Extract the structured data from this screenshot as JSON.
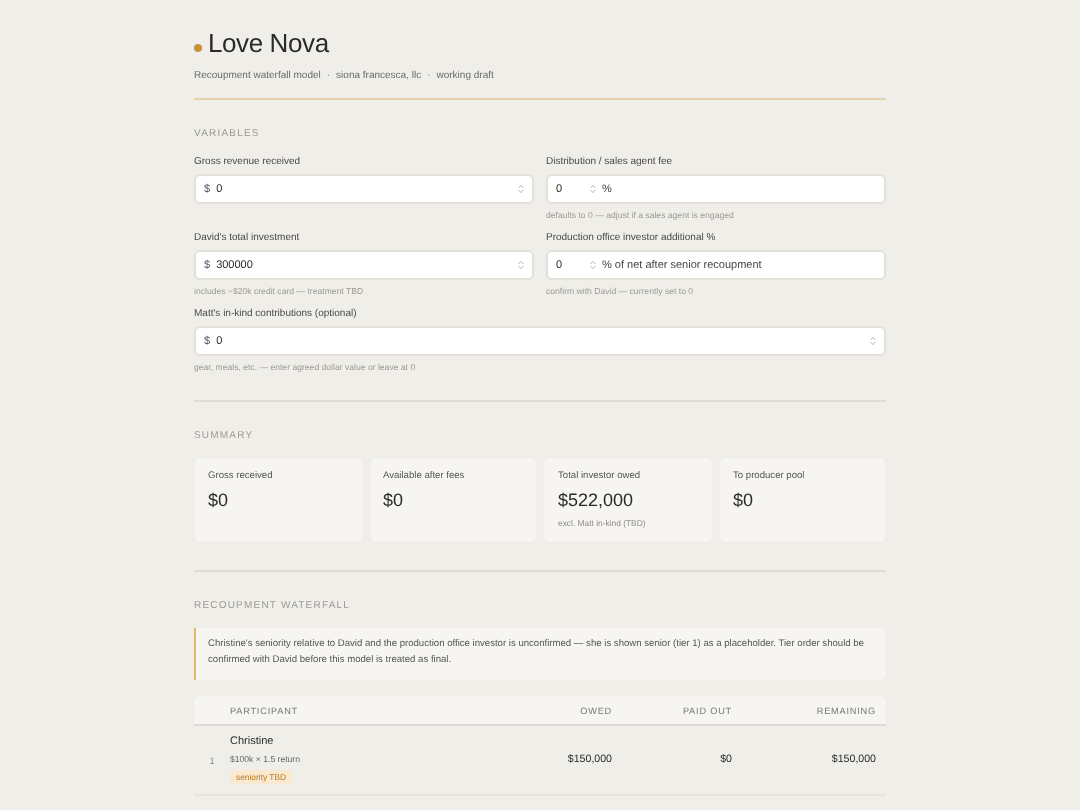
{
  "header": {
    "title": "Love Nova",
    "separator": "·",
    "subtitle": [
      "Recoupment waterfall model",
      "siona francesca, llc",
      "working draft"
    ]
  },
  "variables": {
    "heading": "VARIABLES",
    "rows": [
      [
        {
          "label": "Gross revenue received",
          "prefix": "$",
          "value": "0"
        },
        {
          "label": "Distribution / sales agent fee",
          "value": "0",
          "suffix": "%",
          "hint": "defaults to 0 — adjust if a sales agent is engaged"
        }
      ],
      [
        {
          "label": "David's total investment",
          "prefix": "$",
          "value": "300000",
          "hint": "includes ~$20k credit card — treatment TBD"
        },
        {
          "label": "Production office investor additional %",
          "value": "0",
          "suffix": "% of net after senior recoupment",
          "hint": "confirm with David — currently set to 0"
        }
      ],
      [
        {
          "label": "Matt's in-kind contributions (optional)",
          "prefix": "$",
          "value": "0",
          "hint": "gear, meals, etc. — enter agreed dollar value or leave at 0"
        }
      ]
    ]
  },
  "summary": {
    "heading": "SUMMARY",
    "cards": [
      {
        "label": "Gross received",
        "value": "$0"
      },
      {
        "label": "Available after fees",
        "value": "$0"
      },
      {
        "label": "Total investor owed",
        "value": "$522,000",
        "note": "excl. Matt in-kind (TBD)"
      },
      {
        "label": "To producer pool",
        "value": "$0"
      }
    ]
  },
  "waterfall": {
    "heading": "RECOUPMENT WATERFALL",
    "notice": "Christine's seniority relative to David and the production office investor is unconfirmed — she is shown senior (tier 1) as a placeholder. Tier order should be confirmed with David before this model is treated as final.",
    "columns": [
      "PARTICIPANT",
      "OWED",
      "PAID OUT",
      "REMAINING"
    ],
    "rows": [
      {
        "tier": "1",
        "name": "Christine",
        "detail": "$100k × 1.5 return",
        "tag": "seniority TBD",
        "owed": "$150,000",
        "paid": "$0",
        "remaining": "$150,000"
      }
    ]
  }
}
